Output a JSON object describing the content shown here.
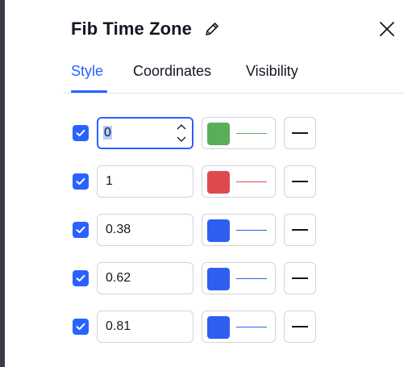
{
  "dialog": {
    "title": "Fib Time Zone",
    "edit_icon": "pencil-icon",
    "close_icon": "close-icon"
  },
  "tabs": [
    {
      "label": "Style",
      "active": true
    },
    {
      "label": "Coordinates",
      "active": false
    },
    {
      "label": "Visibility",
      "active": false
    }
  ],
  "levels": [
    {
      "checked": true,
      "value": "0",
      "focused": true,
      "color": "#5aad5a"
    },
    {
      "checked": true,
      "value": "1",
      "focused": false,
      "color": "#e04a4e"
    },
    {
      "checked": true,
      "value": "0.38",
      "focused": false,
      "color": "#2f5ff0"
    },
    {
      "checked": true,
      "value": "0.62",
      "focused": false,
      "color": "#2f5ff0"
    },
    {
      "checked": true,
      "value": "0.81",
      "focused": false,
      "color": "#2f5ff0"
    }
  ],
  "colors": {
    "accent": "#2962ff",
    "border": "#d1d4dc",
    "text": "#131722"
  }
}
